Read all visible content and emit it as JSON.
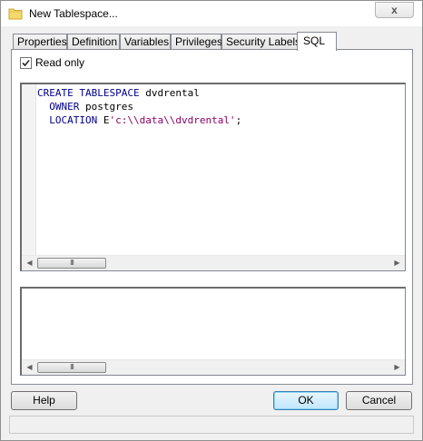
{
  "window": {
    "title": "New Tablespace...",
    "close_glyph": "x",
    "title_icon": "folder-icon"
  },
  "tabs": [
    {
      "label": "Properties",
      "active": false
    },
    {
      "label": "Definition",
      "active": false
    },
    {
      "label": "Variables",
      "active": false
    },
    {
      "label": "Privileges",
      "active": false
    },
    {
      "label": "Security Labels",
      "active": false
    },
    {
      "label": "SQL",
      "active": true
    }
  ],
  "sql_tab": {
    "read_only_label": "Read only",
    "read_only_checked": true,
    "code": {
      "line1_kw": "CREATE TABLESPACE",
      "line1_name": " dvdrental",
      "line2_kw": "OWNER",
      "line2_val": " postgres",
      "line3_kw": "LOCATION",
      "line3_pre": " E",
      "line3_str": "'c:\\\\data\\\\dvdrental'",
      "line3_end": ";"
    },
    "scroll_grip": "III"
  },
  "buttons": {
    "help": "Help",
    "ok": "OK",
    "cancel": "Cancel"
  },
  "colors": {
    "keyword": "#00008b",
    "string": "#8b0066",
    "default_button_border": "#3c7fb1"
  }
}
